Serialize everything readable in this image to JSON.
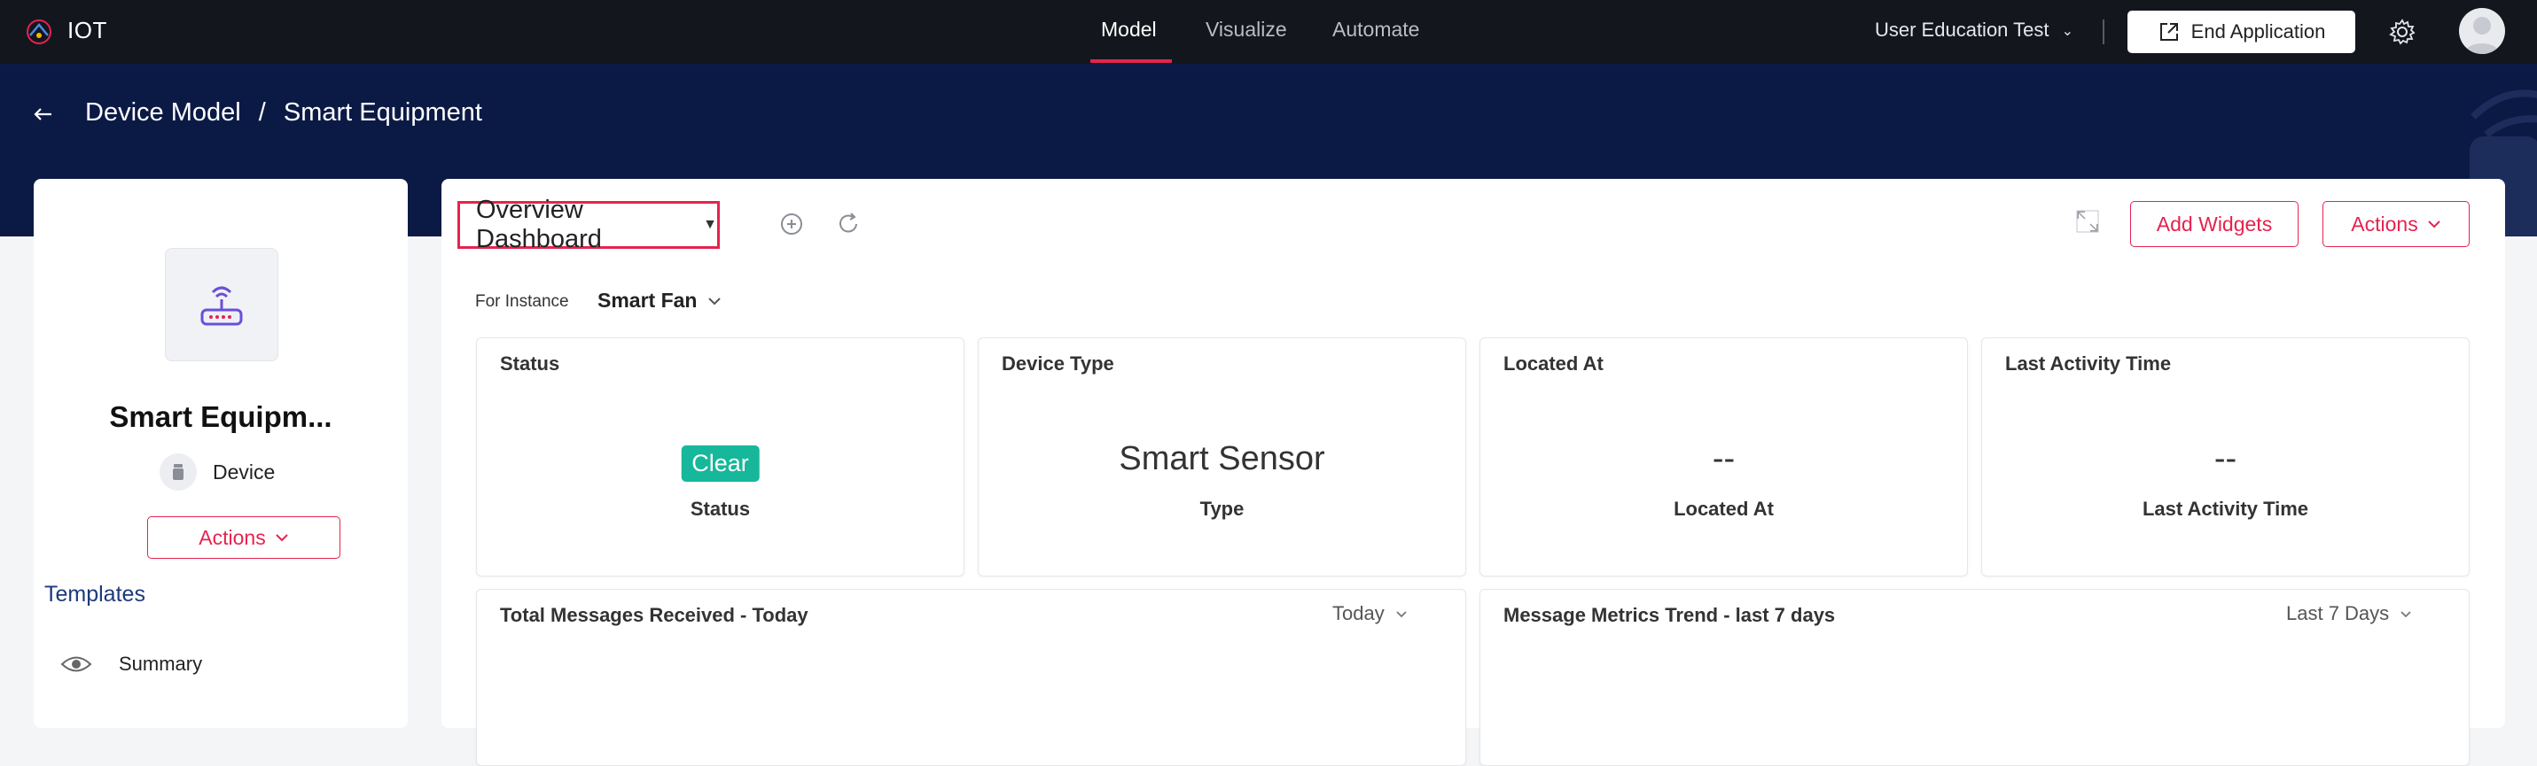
{
  "app": {
    "name": "IOT"
  },
  "nav": {
    "tabs": [
      {
        "label": "Model",
        "active": true
      },
      {
        "label": "Visualize",
        "active": false
      },
      {
        "label": "Automate",
        "active": false
      }
    ]
  },
  "header": {
    "org_label": "User Education Test",
    "end_app_label": "End Application"
  },
  "breadcrumb": {
    "parent": "Device Model",
    "separator": "/",
    "current": "Smart Equipment"
  },
  "left_panel": {
    "device_name": "Smart Equipm...",
    "device_type": "Device",
    "actions_label": "Actions",
    "templates_title": "Templates",
    "templates": [
      {
        "label": "Summary",
        "icon": "eye-icon"
      }
    ]
  },
  "main": {
    "dashboard_select": "Overview Dashboard",
    "add_widgets_label": "Add Widgets",
    "actions_label": "Actions",
    "instance_label": "For Instance",
    "instance_value": "Smart Fan",
    "cards": [
      {
        "title": "Status",
        "badge": "Clear",
        "sub": "Status"
      },
      {
        "title": "Device Type",
        "value": "Smart Sensor",
        "sub": "Type"
      },
      {
        "title": "Located At",
        "value": "--",
        "sub": "Located At"
      },
      {
        "title": "Last Activity Time",
        "value": "--",
        "sub": "Last Activity Time"
      }
    ],
    "widgets": [
      {
        "title": "Total Messages Received - Today",
        "period": "Today"
      },
      {
        "title": "Message Metrics Trend - last 7 days",
        "period": "Last 7 Days"
      }
    ]
  },
  "colors": {
    "accent": "#e5234f",
    "topbar": "#14161d",
    "band": "#0b1a45",
    "status_clear": "#16b79a",
    "device_icon": "#6b4fd8"
  }
}
